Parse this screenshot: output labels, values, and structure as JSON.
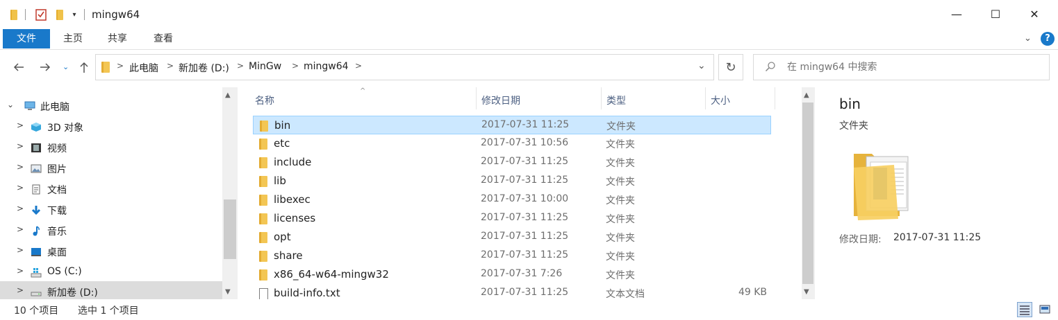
{
  "window": {
    "title": "mingw64",
    "controls": {
      "minimize": "—",
      "maximize": "☐",
      "close": "✕"
    }
  },
  "ribbon": {
    "tabs": [
      "文件",
      "主页",
      "共享",
      "查看"
    ],
    "help": "?"
  },
  "address": {
    "breadcrumbs": [
      "此电脑",
      "新加卷 (D:)",
      "MinGw",
      "mingw64"
    ]
  },
  "search": {
    "placeholder": "在 mingw64 中搜索"
  },
  "nav_pane": {
    "items": [
      {
        "label": "此电脑",
        "icon": "computer-icon",
        "expanded": true
      },
      {
        "label": "3D 对象",
        "icon": "3d-objects-icon"
      },
      {
        "label": "视频",
        "icon": "video-icon"
      },
      {
        "label": "图片",
        "icon": "pictures-icon"
      },
      {
        "label": "文档",
        "icon": "documents-icon"
      },
      {
        "label": "下载",
        "icon": "download-icon"
      },
      {
        "label": "音乐",
        "icon": "music-icon"
      },
      {
        "label": "桌面",
        "icon": "desktop-icon"
      },
      {
        "label": "OS (C:)",
        "icon": "windows-drive-icon"
      },
      {
        "label": "新加卷 (D:)",
        "icon": "drive-icon",
        "selected": true
      }
    ]
  },
  "file_list": {
    "columns": [
      "名称",
      "修改日期",
      "类型",
      "大小"
    ],
    "rows": [
      {
        "name": "bin",
        "date": "2017-07-31 11:25",
        "type": "文件夹",
        "size": "",
        "icon": "folder-icon",
        "selected": true
      },
      {
        "name": "etc",
        "date": "2017-07-31 10:56",
        "type": "文件夹",
        "size": "",
        "icon": "folder-icon"
      },
      {
        "name": "include",
        "date": "2017-07-31 11:25",
        "type": "文件夹",
        "size": "",
        "icon": "folder-icon"
      },
      {
        "name": "lib",
        "date": "2017-07-31 11:25",
        "type": "文件夹",
        "size": "",
        "icon": "folder-icon"
      },
      {
        "name": "libexec",
        "date": "2017-07-31 10:00",
        "type": "文件夹",
        "size": "",
        "icon": "folder-icon"
      },
      {
        "name": "licenses",
        "date": "2017-07-31 11:25",
        "type": "文件夹",
        "size": "",
        "icon": "folder-icon"
      },
      {
        "name": "opt",
        "date": "2017-07-31 11:25",
        "type": "文件夹",
        "size": "",
        "icon": "folder-icon"
      },
      {
        "name": "share",
        "date": "2017-07-31 11:25",
        "type": "文件夹",
        "size": "",
        "icon": "folder-icon"
      },
      {
        "name": "x86_64-w64-mingw32",
        "date": "2017-07-31 7:26",
        "type": "文件夹",
        "size": "",
        "icon": "folder-icon"
      },
      {
        "name": "build-info.txt",
        "date": "2017-07-31 11:25",
        "type": "文本文档",
        "size": "49 KB",
        "icon": "text-file-icon"
      }
    ]
  },
  "preview": {
    "name": "bin",
    "type": "文件夹",
    "date_label": "修改日期:",
    "date_value": "2017-07-31 11:25"
  },
  "status": {
    "count": "10 个项目",
    "selected": "选中 1 个项目"
  },
  "colors": {
    "accent": "#1979ca",
    "selection": "#cce8ff",
    "folder": "#f3c654"
  }
}
